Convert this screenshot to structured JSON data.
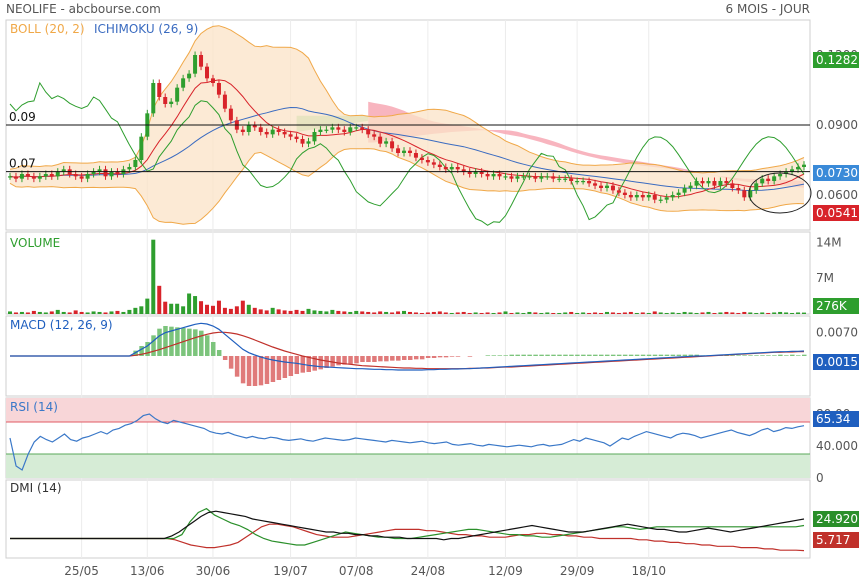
{
  "header": {
    "source": "NEOLIFE - abcbourse.com",
    "period": "6 MOIS - JOUR"
  },
  "colors": {
    "up": "#2e9e2e",
    "down": "#d8232a",
    "boll": "#f0a848",
    "ichimoku": "#3a6bc0",
    "kumo_bull": "#a8e2a8",
    "kumo_bear": "#f7a8b4",
    "macd": "#1f5fbf",
    "signal": "#c0312b",
    "rsi_line": "#3a78c8",
    "dmi_adx": "#111111",
    "dmi_plus": "#2a8f2a",
    "dmi_minus": "#c0312b"
  },
  "chart_data": [
    {
      "type": "candlestick",
      "title": "NEOLIFE",
      "indicators": [
        "BOLL (20, 2)",
        "ICHIMOKU (26, 9)"
      ],
      "x_dates": [
        "25/05",
        "13/06",
        "30/06",
        "19/07",
        "07/08",
        "24/08",
        "12/09",
        "29/09",
        "18/10"
      ],
      "y_ticks": [
        "0.1200",
        "0.0900",
        "0.0600"
      ],
      "ylim": [
        0.045,
        0.135
      ],
      "hlines": [
        {
          "label": "0.09",
          "value": 0.09
        },
        {
          "label": "0.07",
          "value": 0.07
        }
      ],
      "last_close": 0.073,
      "close": [
        0.068,
        0.067,
        0.069,
        0.068,
        0.067,
        0.068,
        0.069,
        0.068,
        0.07,
        0.071,
        0.069,
        0.068,
        0.067,
        0.069,
        0.07,
        0.071,
        0.068,
        0.07,
        0.069,
        0.071,
        0.072,
        0.075,
        0.085,
        0.095,
        0.108,
        0.102,
        0.099,
        0.1,
        0.106,
        0.11,
        0.112,
        0.12,
        0.115,
        0.11,
        0.108,
        0.103,
        0.097,
        0.092,
        0.088,
        0.087,
        0.09,
        0.089,
        0.087,
        0.086,
        0.088,
        0.087,
        0.086,
        0.085,
        0.084,
        0.082,
        0.083,
        0.087,
        0.088,
        0.088,
        0.089,
        0.088,
        0.087,
        0.089,
        0.089,
        0.088,
        0.086,
        0.085,
        0.082,
        0.083,
        0.08,
        0.078,
        0.079,
        0.078,
        0.076,
        0.075,
        0.074,
        0.073,
        0.072,
        0.071,
        0.072,
        0.071,
        0.07,
        0.069,
        0.07,
        0.069,
        0.068,
        0.069,
        0.068,
        0.068,
        0.067,
        0.068,
        0.068,
        0.068,
        0.067,
        0.068,
        0.068,
        0.067,
        0.067,
        0.067,
        0.066,
        0.066,
        0.066,
        0.065,
        0.064,
        0.063,
        0.064,
        0.062,
        0.061,
        0.06,
        0.059,
        0.06,
        0.059,
        0.06,
        0.058,
        0.058,
        0.059,
        0.06,
        0.061,
        0.063,
        0.064,
        0.066,
        0.065,
        0.066,
        0.064,
        0.066,
        0.065,
        0.063,
        0.062,
        0.059,
        0.062,
        0.065,
        0.067,
        0.066,
        0.068,
        0.069,
        0.07,
        0.071,
        0.072,
        0.073
      ],
      "bollinger": {
        "upper_peak": 0.125,
        "lower_trough": 0.055
      },
      "ichimoku": {
        "cloud_top": 0.094,
        "cloud_bottom": 0.075
      }
    },
    {
      "type": "bar",
      "title": "VOLUME",
      "y_ticks": [
        "14M",
        "7M"
      ],
      "ylim": [
        0,
        16
      ],
      "last_value": "276K",
      "values_millions": [
        0.5,
        0.3,
        0.4,
        0.3,
        0.6,
        0.4,
        0.3,
        0.5,
        0.8,
        0.4,
        0.3,
        0.7,
        0.4,
        0.3,
        0.5,
        0.4,
        0.3,
        0.5,
        0.6,
        0.4,
        0.8,
        1.2,
        1.5,
        3.0,
        14.5,
        5.5,
        2.4,
        2.0,
        2.0,
        1.5,
        4.0,
        3.5,
        2.5,
        1.8,
        1.6,
        2.6,
        1.2,
        1.0,
        1.5,
        2.6,
        1.8,
        1.2,
        0.9,
        0.7,
        1.2,
        0.9,
        0.7,
        0.6,
        0.8,
        0.6,
        1.0,
        0.7,
        0.6,
        0.5,
        0.8,
        0.6,
        0.5,
        0.4,
        0.6,
        0.5,
        0.4,
        0.3,
        0.5,
        0.4,
        0.3,
        0.5,
        0.6,
        0.4,
        0.3,
        0.2,
        0.3,
        0.4,
        0.5,
        0.3,
        0.2,
        0.3,
        0.4,
        0.2,
        0.3,
        0.2,
        0.3,
        0.2,
        0.3,
        0.5,
        0.2,
        0.3,
        0.2,
        0.4,
        0.3,
        0.2,
        0.3,
        0.2,
        0.2,
        0.3,
        0.4,
        0.2,
        0.3,
        0.2,
        0.3,
        0.2,
        0.4,
        0.3,
        0.2,
        0.3,
        0.4,
        0.2,
        0.3,
        0.2,
        0.5,
        0.3,
        0.2,
        0.3,
        0.2,
        0.4,
        0.3,
        0.2,
        0.3,
        0.4,
        0.2,
        0.3,
        0.4,
        0.3,
        0.2,
        0.4,
        0.3,
        0.2,
        0.3,
        0.2,
        0.3,
        0.4,
        0.3,
        0.2,
        0.3,
        0.276
      ]
    },
    {
      "type": "line",
      "title": "MACD (12, 26, 9)",
      "y_ticks": [
        "0.0070"
      ],
      "last_value": "0.0015",
      "ylim": [
        -0.012,
        0.012
      ],
      "macd": [
        0.0,
        0.0,
        0.0,
        0.0,
        0.0,
        0.0,
        0.0,
        0.0,
        0.0,
        0.0,
        0.0,
        0.0,
        0.0,
        0.0,
        0.0,
        0.0,
        0.0,
        0.0,
        0.0,
        0.0,
        0.0,
        0.001,
        0.002,
        0.003,
        0.0045,
        0.006,
        0.007,
        0.0075,
        0.008,
        0.0085,
        0.009,
        0.0095,
        0.0098,
        0.0096,
        0.009,
        0.008,
        0.0065,
        0.005,
        0.0035,
        0.002,
        0.001,
        0.0003,
        -0.0003,
        -0.0008,
        -0.0012,
        -0.0015,
        -0.0018,
        -0.002,
        -0.0022,
        -0.0025,
        -0.0028,
        -0.003,
        -0.0032,
        -0.0033,
        -0.0034,
        -0.0035,
        -0.0036,
        -0.0037,
        -0.0038,
        -0.0038,
        -0.0039,
        -0.004,
        -0.004,
        -0.0041,
        -0.0041,
        -0.0042,
        -0.0042,
        -0.0042,
        -0.0042,
        -0.0042,
        -0.0041,
        -0.0041,
        -0.004,
        -0.004,
        -0.0039,
        -0.0039,
        -0.0038,
        -0.0038,
        -0.0037,
        -0.0036,
        -0.0035,
        -0.0034,
        -0.0033,
        -0.0032,
        -0.0031,
        -0.003,
        -0.0029,
        -0.0028,
        -0.0027,
        -0.0026,
        -0.0025,
        -0.0024,
        -0.0023,
        -0.0022,
        -0.0021,
        -0.002,
        -0.0019,
        -0.0018,
        -0.0017,
        -0.0016,
        -0.0015,
        -0.0014,
        -0.0013,
        -0.0012,
        -0.0011,
        -0.001,
        -0.0009,
        -0.0008,
        -0.0007,
        -0.0006,
        -0.0005,
        -0.0004,
        -0.0003,
        -0.0002,
        -0.0001,
        0.0,
        0.0,
        0.0001,
        0.0002,
        0.0003,
        0.0004,
        0.0005,
        0.0006,
        0.0007,
        0.0008,
        0.0009,
        0.001,
        0.0011,
        0.0012,
        0.0013,
        0.0013,
        0.0014,
        0.0014,
        0.0015
      ],
      "signal": [
        0.0,
        0.0,
        0.0,
        0.0,
        0.0,
        0.0,
        0.0,
        0.0,
        0.0,
        0.0,
        0.0,
        0.0,
        0.0,
        0.0,
        0.0,
        0.0,
        0.0,
        0.0,
        0.0,
        0.0,
        0.0,
        0.0002,
        0.0005,
        0.0009,
        0.0014,
        0.0019,
        0.0025,
        0.0031,
        0.0037,
        0.0043,
        0.0049,
        0.0055,
        0.006,
        0.0065,
        0.0069,
        0.0071,
        0.0071,
        0.0069,
        0.0066,
        0.0061,
        0.0055,
        0.0048,
        0.0041,
        0.0034,
        0.0027,
        0.0021,
        0.0015,
        0.001,
        0.0005,
        0.0,
        -0.0004,
        -0.0008,
        -0.0012,
        -0.0015,
        -0.0018,
        -0.0021,
        -0.0023,
        -0.0025,
        -0.0027,
        -0.0029,
        -0.003,
        -0.0031,
        -0.0032,
        -0.0033,
        -0.0034,
        -0.0035,
        -0.0036,
        -0.0036,
        -0.0037,
        -0.0037,
        -0.0038,
        -0.0038,
        -0.0038,
        -0.0038,
        -0.0038,
        -0.0038,
        -0.0038,
        -0.0037,
        -0.0037,
        -0.0036,
        -0.0036,
        -0.0035,
        -0.0034,
        -0.0033,
        -0.0033,
        -0.0032,
        -0.0031,
        -0.003,
        -0.0029,
        -0.0028,
        -0.0027,
        -0.0026,
        -0.0025,
        -0.0024,
        -0.0023,
        -0.0022,
        -0.0021,
        -0.002,
        -0.0019,
        -0.0018,
        -0.0017,
        -0.0016,
        -0.0015,
        -0.0014,
        -0.0013,
        -0.0012,
        -0.0011,
        -0.001,
        -0.0009,
        -0.0008,
        -0.0007,
        -0.0006,
        -0.0005,
        -0.0004,
        -0.0003,
        -0.0002,
        -0.0001,
        0.0,
        0.0001,
        0.0002,
        0.0003,
        0.0004,
        0.0005,
        0.0006,
        0.0007,
        0.0008,
        0.0009,
        0.001,
        0.0011,
        0.0011,
        0.0012,
        0.0012,
        0.0013,
        0.0013
      ]
    },
    {
      "type": "line",
      "title": "RSI (14)",
      "y_ticks": [
        "80.00",
        "40.000",
        "0"
      ],
      "ylim": [
        0,
        100
      ],
      "zones": {
        "overbought": 70,
        "oversold": 30
      },
      "last_value": "65.34",
      "values": [
        50,
        15,
        10,
        30,
        45,
        52,
        48,
        45,
        50,
        55,
        48,
        46,
        50,
        52,
        55,
        58,
        55,
        60,
        62,
        66,
        68,
        72,
        78,
        80,
        74,
        70,
        68,
        72,
        70,
        68,
        66,
        64,
        62,
        58,
        56,
        55,
        57,
        54,
        52,
        50,
        52,
        50,
        49,
        51,
        50,
        48,
        47,
        48,
        49,
        47,
        46,
        48,
        50,
        49,
        48,
        47,
        48,
        50,
        49,
        48,
        47,
        46,
        45,
        47,
        46,
        45,
        44,
        45,
        46,
        44,
        43,
        44,
        45,
        42,
        41,
        42,
        43,
        41,
        40,
        42,
        41,
        40,
        39,
        40,
        41,
        40,
        39,
        41,
        42,
        40,
        41,
        42,
        45,
        48,
        46,
        50,
        48,
        46,
        44,
        40,
        45,
        50,
        48,
        52,
        55,
        58,
        56,
        54,
        52,
        50,
        54,
        56,
        55,
        53,
        50,
        52,
        54,
        56,
        58,
        60,
        57,
        55,
        53,
        56,
        60,
        62,
        58,
        60,
        63,
        62,
        64,
        65.34
      ]
    },
    {
      "type": "line",
      "title": "DMI (14)",
      "y_ticks": [],
      "ylim": [
        0,
        60
      ],
      "last_values": {
        "plus_di": "24.920",
        "minus_di": "5.717"
      },
      "adx": [
        15,
        15,
        15,
        15,
        15,
        15,
        15,
        15,
        15,
        15,
        15,
        15,
        15,
        15,
        15,
        15,
        15,
        15,
        15,
        15,
        15,
        15,
        17,
        20,
        24,
        28,
        32,
        35,
        36,
        35,
        34,
        33,
        32,
        30,
        29,
        28,
        27,
        26,
        25,
        24,
        23,
        22,
        21,
        20,
        20,
        19,
        19,
        18,
        18,
        17,
        17,
        16,
        16,
        16,
        15,
        15,
        15,
        15,
        15,
        14,
        15,
        15,
        16,
        17,
        18,
        19,
        20,
        21,
        22,
        23,
        24,
        25,
        24,
        23,
        22,
        21,
        20,
        20,
        20,
        21,
        22,
        23,
        24,
        25,
        26,
        25,
        24,
        23,
        22,
        22,
        21,
        20,
        20,
        21,
        22,
        23,
        22,
        21,
        20,
        21,
        22,
        23,
        24,
        25,
        26,
        27,
        28,
        29,
        30
      ],
      "plus_di": [
        15,
        15,
        15,
        15,
        15,
        15,
        15,
        15,
        15,
        15,
        15,
        15,
        15,
        15,
        15,
        15,
        15,
        15,
        15,
        15,
        15,
        18,
        28,
        35,
        38,
        33,
        30,
        27,
        25,
        22,
        18,
        15,
        13,
        12,
        11,
        10,
        10,
        12,
        14,
        16,
        18,
        20,
        19,
        18,
        17,
        16,
        16,
        15,
        15,
        15,
        16,
        17,
        18,
        19,
        20,
        21,
        22,
        22,
        21,
        20,
        19,
        18,
        18,
        17,
        17,
        16,
        16,
        17,
        18,
        19,
        20,
        21,
        22,
        23,
        24,
        24,
        23,
        22,
        23,
        24,
        24,
        24,
        24,
        24,
        24,
        24,
        24,
        24,
        24,
        24,
        24,
        24,
        24,
        24,
        24,
        24,
        24,
        25
      ],
      "minus_di": [
        15,
        15,
        15,
        15,
        15,
        15,
        15,
        15,
        15,
        15,
        15,
        15,
        15,
        15,
        15,
        15,
        15,
        15,
        15,
        15,
        15,
        14,
        12,
        10,
        9,
        8,
        8,
        9,
        10,
        12,
        16,
        20,
        24,
        26,
        26,
        25,
        24,
        22,
        20,
        18,
        17,
        16,
        16,
        16,
        17,
        18,
        19,
        20,
        21,
        22,
        22,
        22,
        22,
        21,
        21,
        20,
        19,
        18,
        18,
        17,
        17,
        16,
        16,
        16,
        17,
        18,
        18,
        19,
        19,
        18,
        18,
        17,
        17,
        16,
        16,
        15,
        15,
        15,
        15,
        15,
        14,
        14,
        13,
        13,
        12,
        12,
        11,
        11,
        10,
        10,
        9,
        9,
        9,
        8,
        8,
        8,
        7,
        7,
        6,
        6,
        6,
        5.717
      ]
    }
  ]
}
